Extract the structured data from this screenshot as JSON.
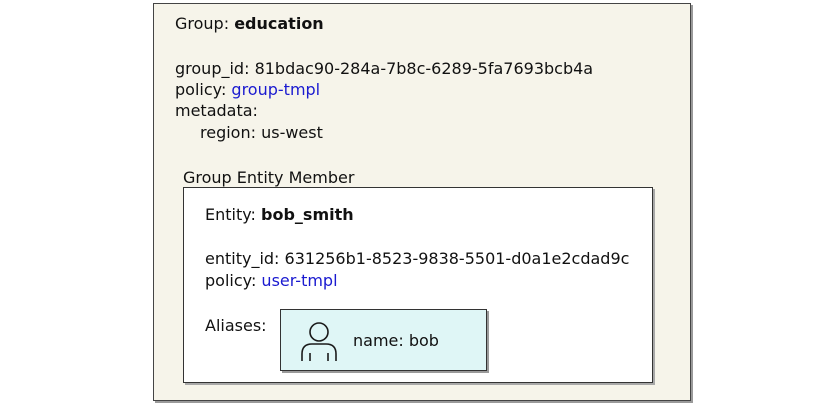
{
  "group": {
    "label": "Group:",
    "name": "education",
    "group_id_label": "group_id:",
    "group_id": "81bdac90-284a-7b8c-6289-5fa7693bcb4a",
    "policy_label": "policy:",
    "policy": "group-tmpl",
    "metadata_label": "metadata:",
    "region_label": "region:",
    "region": "us-west"
  },
  "member_section": {
    "title": "Group Entity Member"
  },
  "entity": {
    "label": "Entity:",
    "name": "bob_smith",
    "entity_id_label": "entity_id:",
    "entity_id": "631256b1-8523-9838-5501-d0a1e2cdad9c",
    "policy_label": "policy:",
    "policy": "user-tmpl",
    "aliases_label": "Aliases:"
  },
  "alias": {
    "icon": "person-icon",
    "name_label": "name:",
    "name": "bob"
  },
  "colors": {
    "group_bg": "#f6f4ea",
    "alias_bg": "#dff6f6",
    "link": "#1a1ad0"
  }
}
